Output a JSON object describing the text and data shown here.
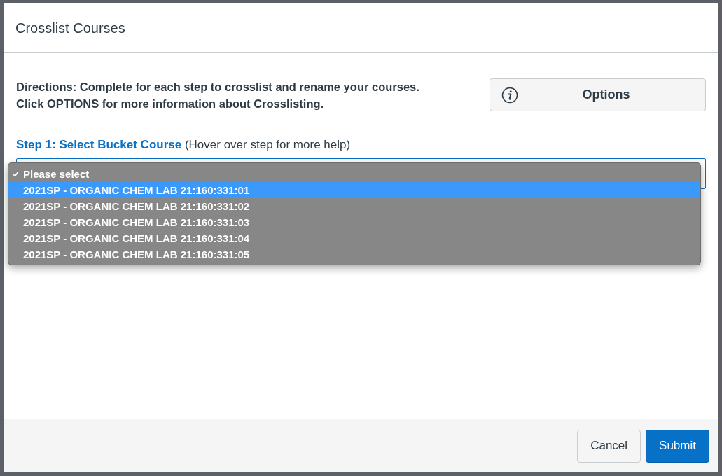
{
  "dialog": {
    "title": "Crosslist Courses"
  },
  "directions": [
    "Directions: Complete for each step to crosslist and rename your courses.",
    "Click OPTIONS for more information about Crosslisting."
  ],
  "options_button": {
    "label": "Options"
  },
  "step": {
    "title": "Step 1: Select Bucket Course",
    "hint": "(Hover over step for more help)"
  },
  "dropdown": {
    "options": [
      {
        "label": "Please select",
        "checked": true,
        "selected": false
      },
      {
        "label": "2021SP - ORGANIC CHEM LAB 21:160:331:01",
        "checked": false,
        "selected": true
      },
      {
        "label": "2021SP - ORGANIC CHEM LAB 21:160:331:02",
        "checked": false,
        "selected": false
      },
      {
        "label": "2021SP - ORGANIC CHEM LAB 21:160:331:03",
        "checked": false,
        "selected": false
      },
      {
        "label": "2021SP - ORGANIC CHEM LAB 21:160:331:04",
        "checked": false,
        "selected": false
      },
      {
        "label": "2021SP - ORGANIC CHEM LAB 21:160:331:05",
        "checked": false,
        "selected": false
      }
    ]
  },
  "footer_buttons": [
    {
      "label": "Cancel",
      "kind": "secondary"
    },
    {
      "label": "Submit",
      "kind": "primary"
    }
  ]
}
